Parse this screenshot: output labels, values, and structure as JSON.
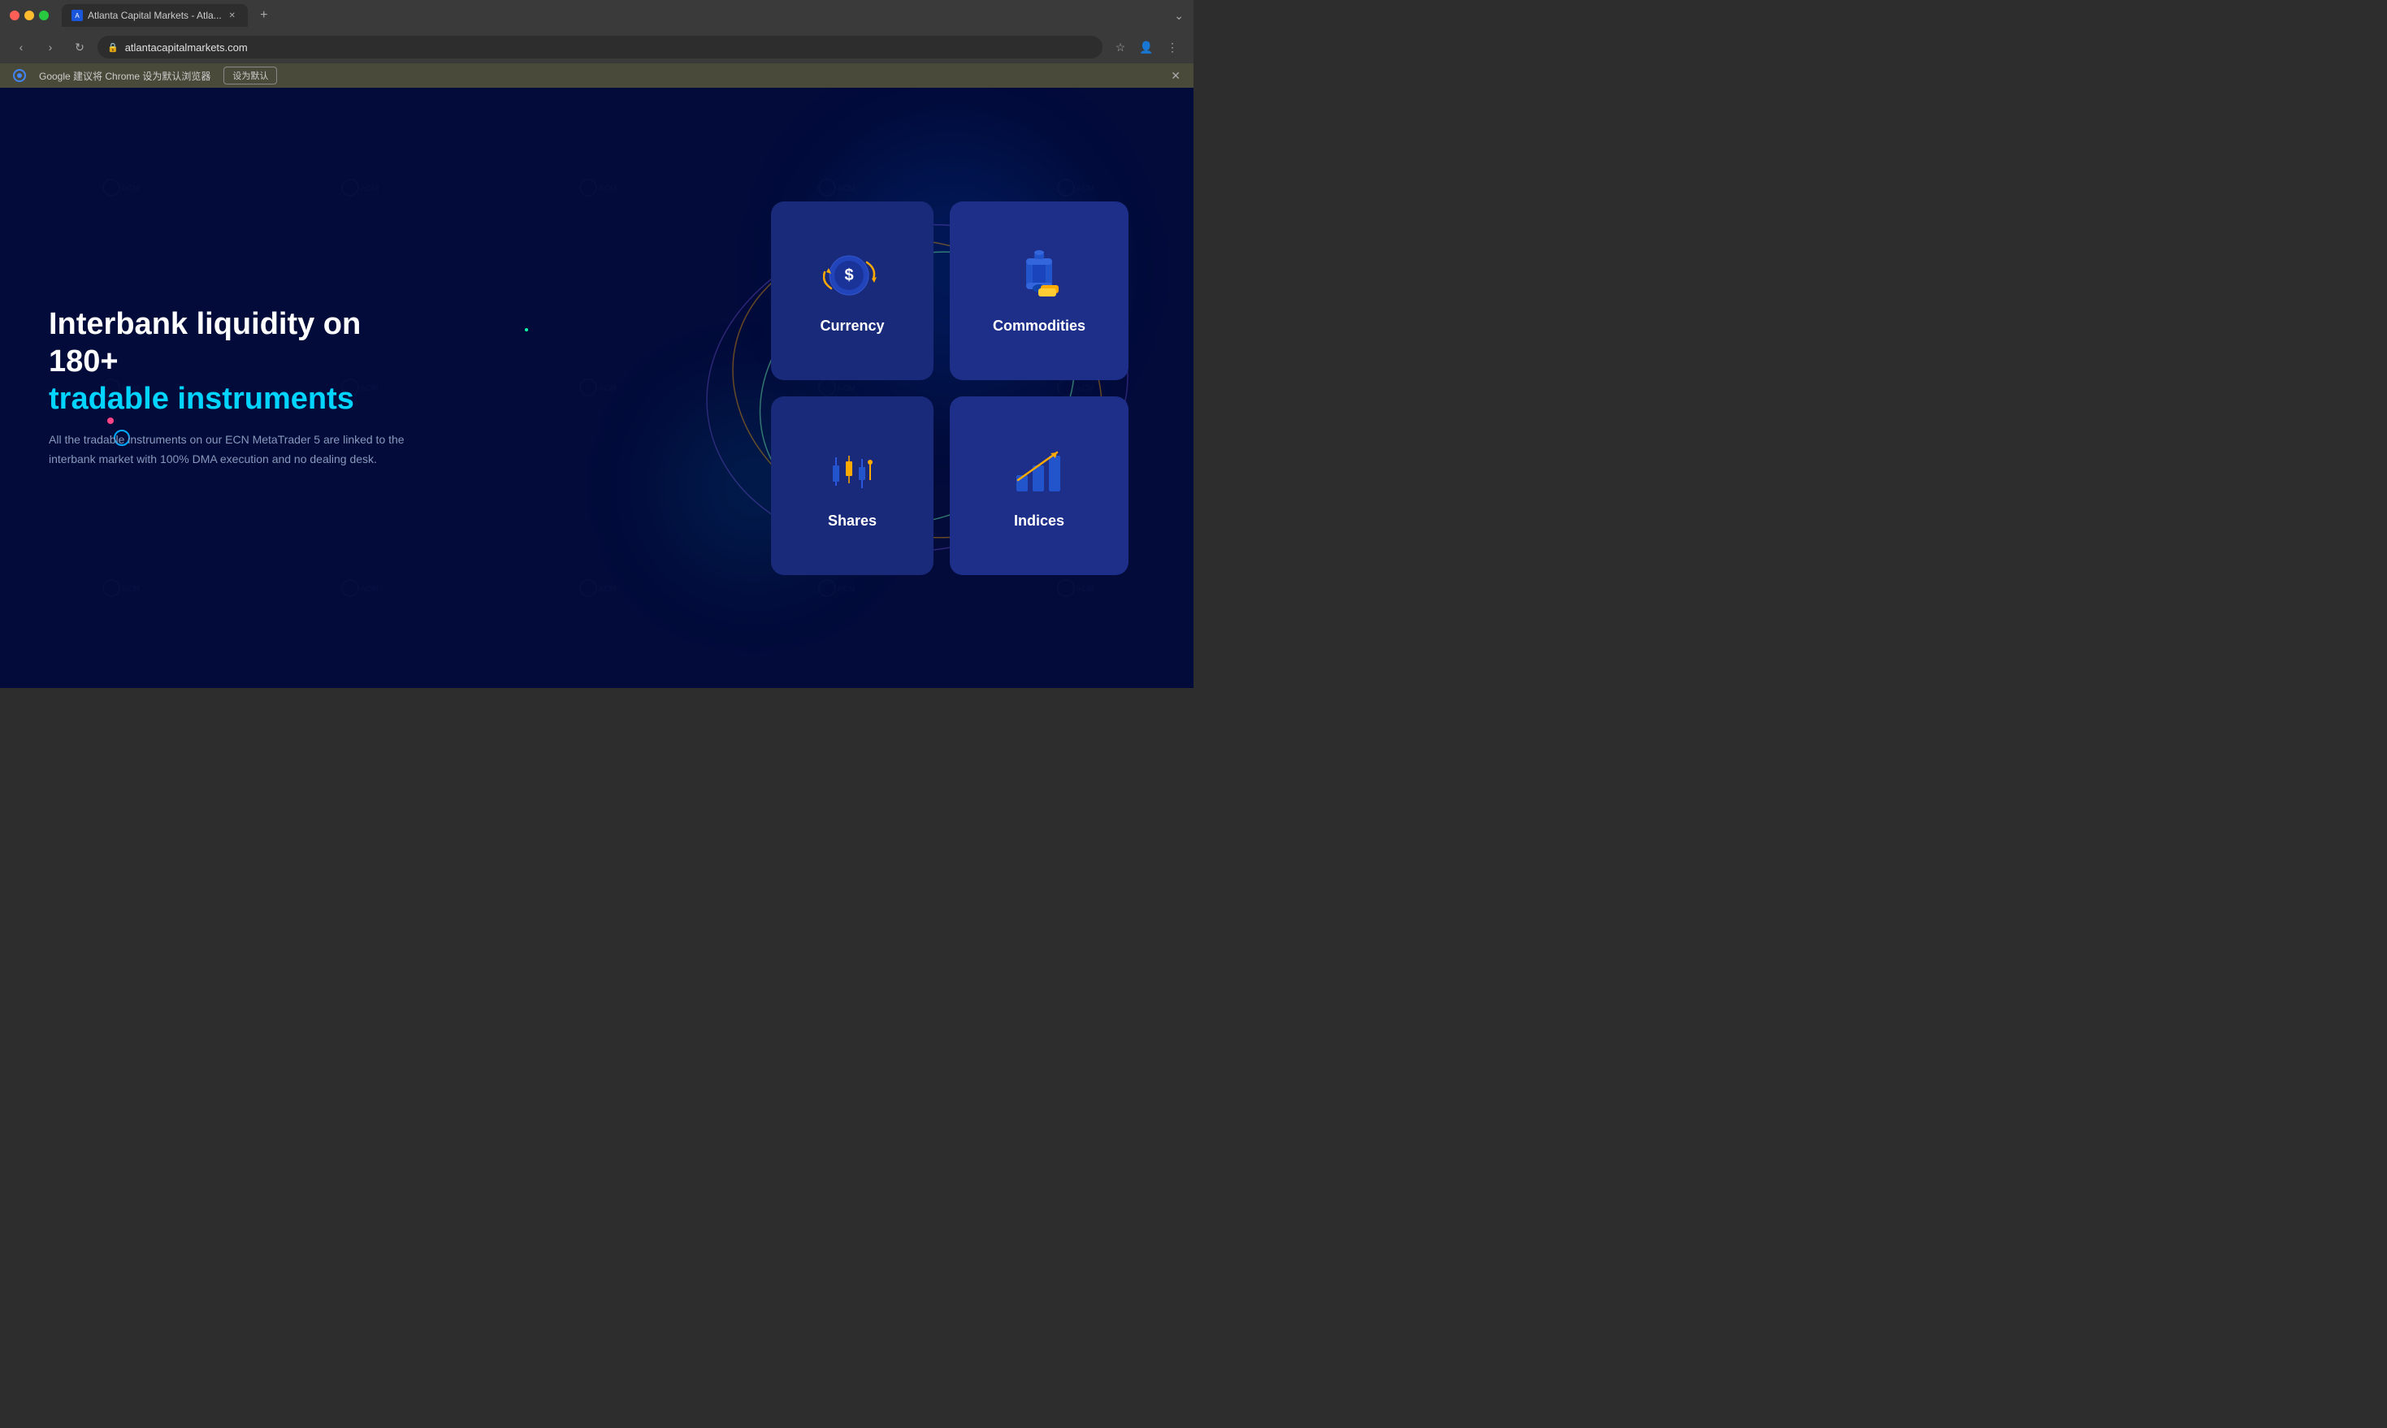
{
  "browser": {
    "traffic_lights": [
      "close",
      "minimize",
      "maximize"
    ],
    "tab": {
      "label": "Atlanta Capital Markets - Atla...",
      "favicon_text": "A",
      "close_icon": "✕"
    },
    "new_tab_icon": "+",
    "nav": {
      "back": "‹",
      "forward": "›",
      "refresh": "↻",
      "url": "atlantacapitalmarkets.com",
      "lock_icon": "🔒",
      "bookmark_icon": "☆",
      "profile_icon": "👤",
      "menu_icon": "⋮",
      "more_icon": "⌄"
    },
    "infobar": {
      "text": "Google 建议将 Chrome 设为默认浏览器",
      "button": "设为默认",
      "close": "✕"
    }
  },
  "page": {
    "headline_line1": "Interbank liquidity on 180+",
    "headline_line2": "tradable instruments",
    "subtext": "All the tradable instruments on our ECN MetaTrader 5 are linked to the interbank market with 100% DMA execution and no dealing desk.",
    "cards": [
      {
        "id": "currency",
        "label": "Currency",
        "icon": "currency"
      },
      {
        "id": "commodities",
        "label": "Commodities",
        "icon": "commodities"
      },
      {
        "id": "shares",
        "label": "Shares",
        "icon": "shares"
      },
      {
        "id": "indices",
        "label": "Indices",
        "icon": "indices"
      }
    ],
    "colors": {
      "card_bg": "#1a2a7a",
      "card_bg_alt": "#1e2f8a",
      "headline_color": "#ffffff",
      "highlight_color": "#00d4ff",
      "subtext_color": "#8899bb",
      "page_bg": "#020b3a"
    }
  }
}
